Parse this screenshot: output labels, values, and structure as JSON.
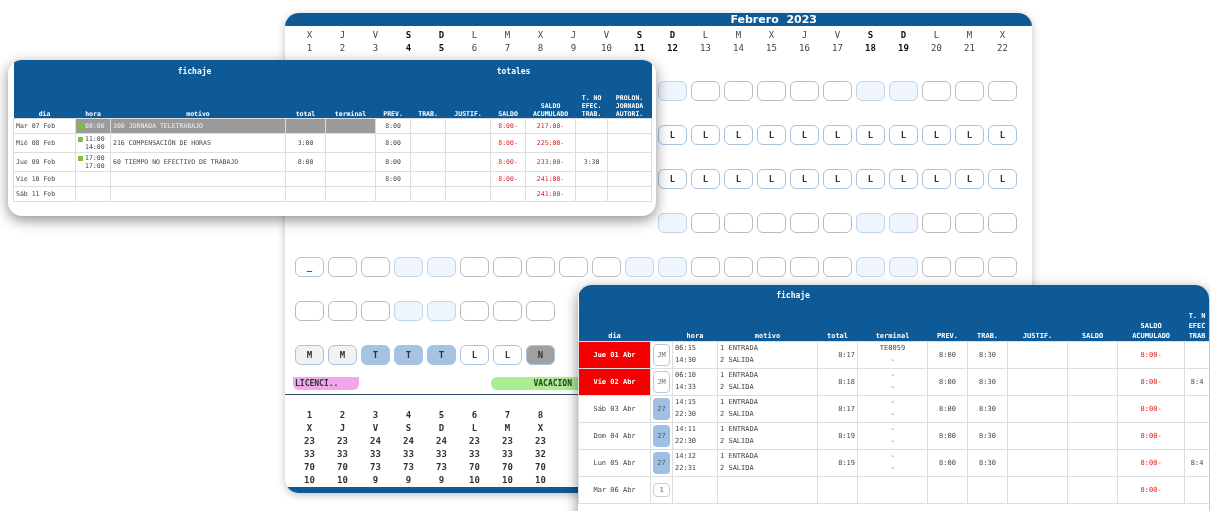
{
  "calendar": {
    "month": "Febrero",
    "year": "2023",
    "days": [
      {
        "letter": "X",
        "number": "1",
        "weekend": false
      },
      {
        "letter": "J",
        "number": "2",
        "weekend": false
      },
      {
        "letter": "V",
        "number": "3",
        "weekend": false
      },
      {
        "letter": "S",
        "number": "4",
        "weekend": true
      },
      {
        "letter": "D",
        "number": "5",
        "weekend": true
      },
      {
        "letter": "L",
        "number": "6",
        "weekend": false
      },
      {
        "letter": "M",
        "number": "7",
        "weekend": false
      },
      {
        "letter": "X",
        "number": "8",
        "weekend": false
      },
      {
        "letter": "J",
        "number": "9",
        "weekend": false
      },
      {
        "letter": "V",
        "number": "10",
        "weekend": false
      },
      {
        "letter": "S",
        "number": "11",
        "weekend": true
      },
      {
        "letter": "D",
        "number": "12",
        "weekend": true
      },
      {
        "letter": "L",
        "number": "13",
        "weekend": false
      },
      {
        "letter": "M",
        "number": "14",
        "weekend": false
      },
      {
        "letter": "X",
        "number": "15",
        "weekend": false
      },
      {
        "letter": "J",
        "number": "16",
        "weekend": false
      },
      {
        "letter": "V",
        "number": "17",
        "weekend": false
      },
      {
        "letter": "S",
        "number": "18",
        "weekend": true
      },
      {
        "letter": "D",
        "number": "19",
        "weekend": true
      },
      {
        "letter": "L",
        "number": "20",
        "weekend": false
      },
      {
        "letter": "M",
        "number": "21",
        "weekend": false
      },
      {
        "letter": "X",
        "number": "22",
        "weekend": false
      }
    ],
    "upper_rows": [
      {
        "cells": [
          {
            "kind": "blank"
          },
          {
            "kind": "blank"
          },
          {
            "kind": "blank"
          },
          {
            "kind": "blank"
          },
          {
            "kind": "blank"
          },
          {
            "kind": "blank"
          },
          {
            "kind": "blank"
          },
          {
            "kind": "blank"
          },
          {
            "kind": "blank"
          },
          {
            "kind": "blank"
          },
          {
            "kind": "blank"
          }
        ]
      },
      {
        "cells": [
          {
            "kind": "letter",
            "label": "L",
            "color": "#ffffff"
          },
          {
            "kind": "letter",
            "label": "L",
            "color": "#ffffff"
          },
          {
            "kind": "letter",
            "label": "L",
            "color": "#ffffff"
          },
          {
            "kind": "letter",
            "label": "L",
            "color": "#ffffff"
          },
          {
            "kind": "letter",
            "label": "L",
            "color": "#ffffff"
          },
          {
            "kind": "letter",
            "label": "L",
            "color": "#ffffff"
          },
          {
            "kind": "letter",
            "label": "L",
            "color": "#ffffff"
          },
          {
            "kind": "letter",
            "label": "L",
            "color": "#ffffff"
          },
          {
            "kind": "letter",
            "label": "L",
            "color": "#ffffff"
          },
          {
            "kind": "letter",
            "label": "L",
            "color": "#ffffff"
          },
          {
            "kind": "letter",
            "label": "L",
            "color": "#ffffff"
          }
        ]
      },
      {
        "cells": [
          {
            "kind": "letter",
            "label": "L",
            "color": "#ffffff"
          },
          {
            "kind": "letter",
            "label": "L",
            "color": "#ffffff"
          },
          {
            "kind": "letter",
            "label": "L",
            "color": "#ffffff"
          },
          {
            "kind": "letter",
            "label": "L",
            "color": "#ffffff"
          },
          {
            "kind": "letter",
            "label": "L",
            "color": "#ffffff"
          },
          {
            "kind": "letter",
            "label": "L",
            "color": "#ffffff"
          },
          {
            "kind": "letter",
            "label": "L",
            "color": "#ffffff"
          },
          {
            "kind": "letter",
            "label": "L",
            "color": "#ffffff"
          },
          {
            "kind": "letter",
            "label": "L",
            "color": "#ffffff"
          },
          {
            "kind": "letter",
            "label": "L",
            "color": "#ffffff"
          },
          {
            "kind": "letter",
            "label": "L",
            "color": "#ffffff"
          }
        ]
      },
      {
        "cells": [
          {
            "kind": "blank"
          },
          {
            "kind": "blank"
          },
          {
            "kind": "blank"
          },
          {
            "kind": "blank"
          },
          {
            "kind": "blank"
          },
          {
            "kind": "blank"
          },
          {
            "kind": "blank"
          },
          {
            "kind": "blank"
          },
          {
            "kind": "blank"
          },
          {
            "kind": "blank"
          },
          {
            "kind": "blank"
          }
        ]
      }
    ],
    "lower_rows": [
      {
        "cells": [
          {
            "kind": "letter",
            "label": "_",
            "color": "#ffffff"
          },
          {
            "kind": "blank"
          },
          {
            "kind": "blank"
          },
          {
            "kind": "blank"
          },
          {
            "kind": "blank"
          },
          {
            "kind": "blank"
          },
          {
            "kind": "blank"
          },
          {
            "kind": "blank"
          },
          {
            "kind": "blank"
          },
          {
            "kind": "blank"
          },
          {
            "kind": "blank"
          },
          {
            "kind": "blank"
          },
          {
            "kind": "blank"
          },
          {
            "kind": "blank"
          },
          {
            "kind": "blank"
          },
          {
            "kind": "blank"
          },
          {
            "kind": "blank"
          },
          {
            "kind": "blank"
          },
          {
            "kind": "blank"
          },
          {
            "kind": "blank"
          },
          {
            "kind": "blank"
          },
          {
            "kind": "blank"
          }
        ]
      },
      {
        "cells": [
          {
            "kind": "blank"
          },
          {
            "kind": "blank"
          },
          {
            "kind": "blank"
          },
          {
            "kind": "blank"
          },
          {
            "kind": "blank"
          },
          {
            "kind": "blank"
          },
          {
            "kind": "blank"
          },
          {
            "kind": "blank"
          }
        ]
      },
      {
        "cells": [
          {
            "kind": "letter",
            "label": "M",
            "color": "#f2f2f2"
          },
          {
            "kind": "letter",
            "label": "M",
            "color": "#f2f2f2"
          },
          {
            "kind": "letter",
            "label": "T",
            "color": "#a7c3e3"
          },
          {
            "kind": "letter",
            "label": "T",
            "color": "#a7c3e3"
          },
          {
            "kind": "letter",
            "label": "T",
            "color": "#a7c3e3"
          },
          {
            "kind": "letter",
            "label": "L",
            "color": "#ffffff"
          },
          {
            "kind": "letter",
            "label": "L",
            "color": "#ffffff"
          },
          {
            "kind": "letter",
            "label": "N",
            "color": "#a0a0a0"
          }
        ]
      }
    ],
    "tags": [
      {
        "label": "LICENCI..",
        "color": "#f2a6ee"
      },
      {
        "label": "VACACION",
        "color": "#a9ef8f"
      }
    ],
    "summary": [
      {
        "day": "1",
        "letter": "X",
        "values": [
          "23",
          "33",
          "70",
          "10"
        ]
      },
      {
        "day": "2",
        "letter": "J",
        "values": [
          "23",
          "33",
          "70",
          "10"
        ]
      },
      {
        "day": "3",
        "letter": "V",
        "values": [
          "24",
          "33",
          "73",
          "9"
        ]
      },
      {
        "day": "4",
        "letter": "S",
        "values": [
          "24",
          "33",
          "73",
          "9"
        ]
      },
      {
        "day": "5",
        "letter": "D",
        "values": [
          "24",
          "33",
          "73",
          "9"
        ]
      },
      {
        "day": "6",
        "letter": "L",
        "values": [
          "23",
          "33",
          "70",
          "10"
        ]
      },
      {
        "day": "7",
        "letter": "M",
        "values": [
          "23",
          "33",
          "70",
          "10"
        ]
      },
      {
        "day": "8",
        "letter": "X",
        "values": [
          "23",
          "32",
          "70",
          "10"
        ]
      }
    ]
  },
  "fichaje_feb": {
    "groups": [
      {
        "label": "fichaje",
        "columns": [
          [
            "dia"
          ],
          [
            "hora"
          ],
          [
            "motivo"
          ],
          [
            "total"
          ],
          [
            "terminal"
          ]
        ]
      },
      {
        "label": "totales",
        "columns": [
          [
            "PREV."
          ],
          [
            "TRAB."
          ],
          [
            "JUSTIF."
          ],
          [
            "SALDO"
          ],
          [
            "SALDO",
            "ACUMULADO"
          ],
          [
            "T. NO",
            "EFEC.",
            "TRAB."
          ],
          [
            "PROLON.",
            "JORNADA",
            "AUTORI."
          ]
        ]
      }
    ],
    "rows": [
      {
        "dia": "Mar 07 Feb",
        "selected": true,
        "hora": [
          "08:00"
        ],
        "motivo": "300 JORNADA TELETRABAJO",
        "prev": "8:00",
        "saldo": "8:00-",
        "saldo_acumulado": "217:00-"
      },
      {
        "dia": "Mié 08 Feb",
        "selected": false,
        "hora": [
          "11:00",
          "14:00"
        ],
        "motivo": "216 COMPENSACIÓN DE HORAS",
        "total": "3:00",
        "prev": "8:00",
        "saldo": "8:00-",
        "saldo_acumulado": "225:00-"
      },
      {
        "dia": "Jue 09 Feb",
        "selected": false,
        "hora": [
          "17:00",
          "17:00"
        ],
        "motivo": "60 TIEMPO NO EFECTIVO DE TRABAJO",
        "total": "8:00",
        "prev": "8:00",
        "saldo": "8:00-",
        "saldo_acumulado": "233:00-",
        "t_no": "3:30"
      },
      {
        "dia": "Vie 10 Feb",
        "selected": false,
        "prev": "8:00",
        "saldo": "8:00-",
        "saldo_acumulado": "241:00-"
      },
      {
        "dia": "Sáb 11 Feb",
        "selected": false,
        "saldo_acumulado": "241:00-"
      }
    ]
  },
  "fichaje_abr": {
    "groups": [
      {
        "label": "fichaje",
        "columns": [
          [
            "dia"
          ],
          [],
          [
            "hora"
          ],
          [
            "motivo"
          ],
          [
            "total"
          ],
          [
            "terminal"
          ],
          [
            "PREV."
          ],
          [
            "TRAB."
          ]
        ]
      },
      {
        "columns": [
          [
            "JUSTIF."
          ],
          [
            "SALDO"
          ],
          [
            "SALDO",
            "ACUMULADO"
          ],
          [
            "T. N",
            "EFEC",
            "TRAB"
          ]
        ]
      }
    ],
    "rows": [
      {
        "dia": "Jue 01 Abr",
        "alert": true,
        "badge": {
          "label": "JM",
          "kind": "outline"
        },
        "entries": [
          {
            "hora": "06:15",
            "motivo": "1 ENTRADA",
            "terminal": "TE0059"
          },
          {
            "hora": "14:30",
            "motivo": "2 SALIDA",
            "terminal": "-"
          }
        ],
        "total": "8:17",
        "prev": "8:00",
        "trab": "8:30",
        "saldo_acumulado": "8:00-"
      },
      {
        "dia": "Vie 02 Abr",
        "alert": true,
        "badge": {
          "label": "JM",
          "kind": "outline"
        },
        "entries": [
          {
            "hora": "06:10",
            "motivo": "1 ENTRADA",
            "terminal": "-"
          },
          {
            "hora": "14:33",
            "motivo": "2 SALIDA",
            "terminal": "-"
          }
        ],
        "total": "8:18",
        "prev": "8:00",
        "trab": "8:30",
        "saldo_acumulado": "8:00-",
        "t_no": "8:4"
      },
      {
        "dia": "Sáb 03 Abr",
        "alert": false,
        "badge": {
          "label": "27",
          "kind": "filled"
        },
        "entries": [
          {
            "hora": "14:15",
            "motivo": "1 ENTRADA",
            "terminal": "-"
          },
          {
            "hora": "22:30",
            "motivo": "2 SALIDA",
            "terminal": "-"
          }
        ],
        "total": "8:17",
        "prev": "8:00",
        "trab": "8:30",
        "saldo_acumulado": "8:00-"
      },
      {
        "dia": "Dom 04 Abr",
        "alert": false,
        "badge": {
          "label": "27",
          "kind": "filled"
        },
        "entries": [
          {
            "hora": "14:11",
            "motivo": "1 ENTRADA",
            "terminal": "-"
          },
          {
            "hora": "22:30",
            "motivo": "2 SALIDA",
            "terminal": "-"
          }
        ],
        "total": "8:19",
        "prev": "8:00",
        "trab": "8:30",
        "saldo_acumulado": "8:00-"
      },
      {
        "dia": "Lun 05 Abr",
        "alert": false,
        "badge": {
          "label": "27",
          "kind": "filled"
        },
        "entries": [
          {
            "hora": "14:12",
            "motivo": "1 ENTRADA",
            "terminal": "-"
          },
          {
            "hora": "22:31",
            "motivo": "2 SALIDA",
            "terminal": "-"
          }
        ],
        "total": "8:19",
        "prev": "8:00",
        "trab": "8:30",
        "saldo_acumulado": "8:00-",
        "t_no": "8:4"
      },
      {
        "dia": "Mar 06 Abr",
        "alert": false,
        "badge": {
          "label": "1",
          "kind": "plain"
        },
        "saldo_acumulado": "8:00-"
      }
    ]
  }
}
